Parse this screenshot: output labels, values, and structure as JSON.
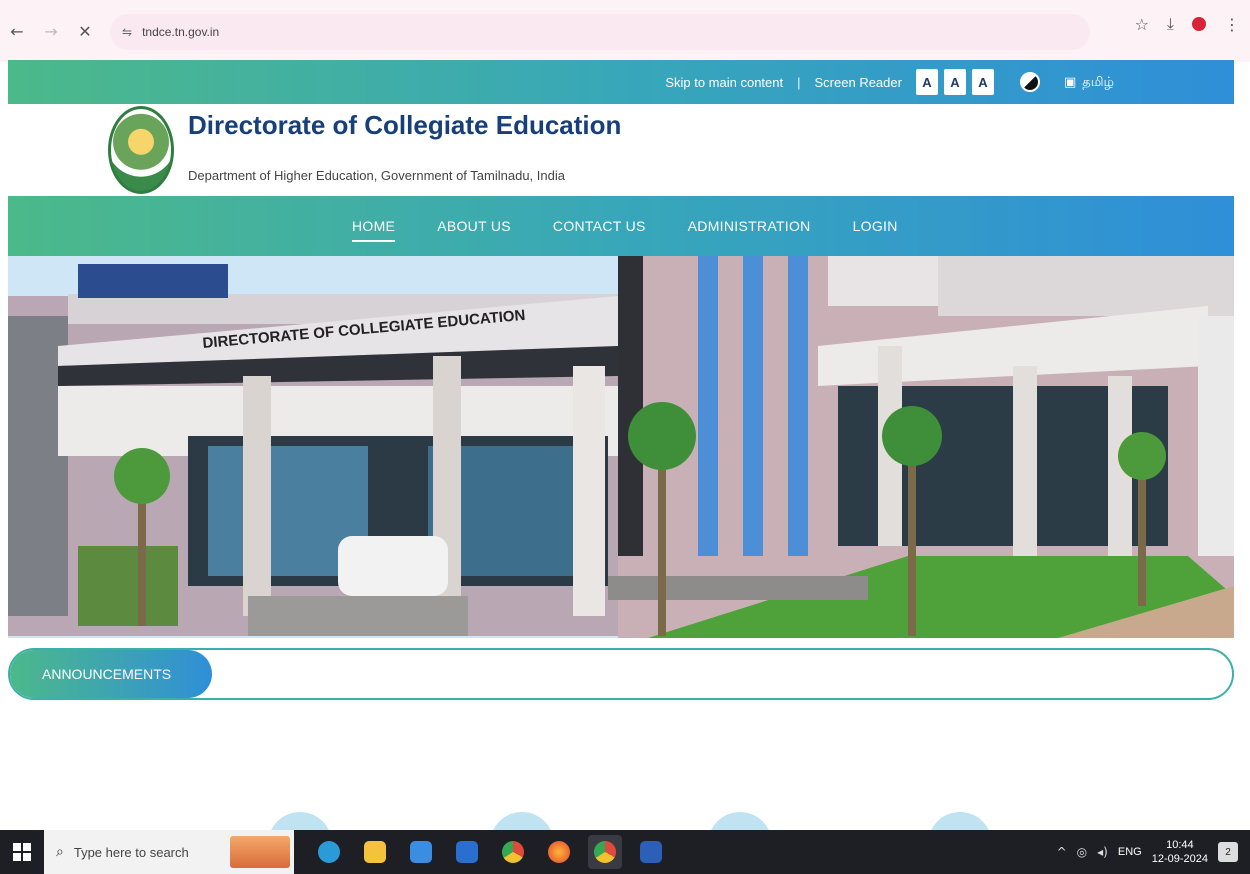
{
  "browser": {
    "url": "tndce.tn.gov.in",
    "back_icon": "arrow-left-icon",
    "forward_icon": "arrow-right-icon",
    "stop_icon": "close-icon"
  },
  "topbar": {
    "skip_link": "Skip to main content",
    "separator": "|",
    "screen_reader": "Screen Reader",
    "font_sizes": [
      "A",
      "A",
      "A"
    ],
    "language": "தமிழ்"
  },
  "header": {
    "title": "Directorate of Collegiate Education",
    "subtitle": "Department of Higher Education, Government of Tamilnadu, India"
  },
  "nav": {
    "items": [
      "HOME",
      "ABOUT US",
      "CONTACT US",
      "ADMINISTRATION",
      "LOGIN"
    ],
    "active": "HOME"
  },
  "banner": {
    "sign_left": "DIRECTORATE OF COLLEGIATE EDUCATION"
  },
  "announcements": {
    "label": "ANNOUNCEMENTS"
  },
  "taskbar": {
    "search_placeholder": "Type here to search",
    "tray_lang": "ENG",
    "time": "10:44",
    "date": "12-09-2024",
    "notif_count": "2"
  },
  "colors": {
    "gradient_start": "#4cb98a",
    "gradient_end": "#2f8fd8",
    "title_blue": "#173f7a"
  }
}
